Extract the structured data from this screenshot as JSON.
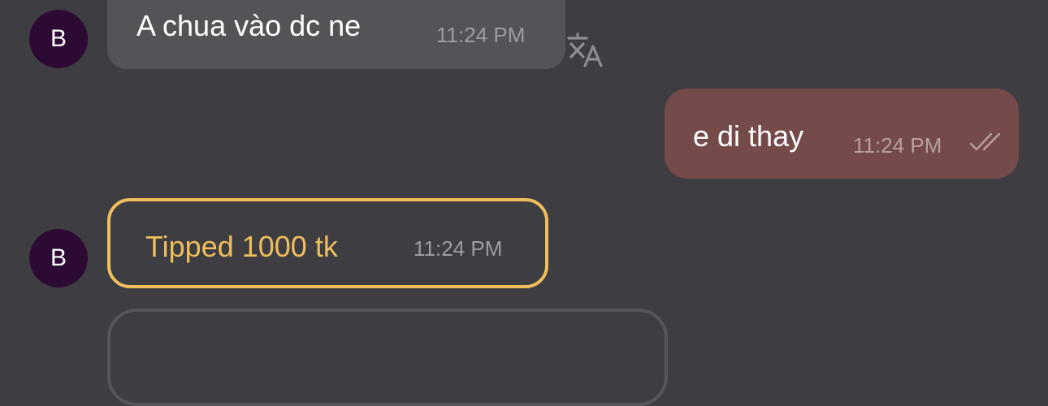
{
  "messages": [
    {
      "sender_initial": "B",
      "text": "A chua vào dc ne",
      "time": "11:24 PM"
    },
    {
      "text": "e di thay",
      "time": "11:24 PM"
    },
    {
      "sender_initial": "B",
      "text": "Tipped 1000 tk",
      "time": "11:24 PM"
    }
  ],
  "icons": {
    "translate": "translate-icon",
    "read_receipt": "double-check-icon"
  },
  "colors": {
    "background": "#3e3e42",
    "incoming_bubble": "#545458",
    "outgoing_bubble": "#744a4b",
    "tip_accent": "#f0be5c",
    "avatar": "#2d0a33"
  }
}
